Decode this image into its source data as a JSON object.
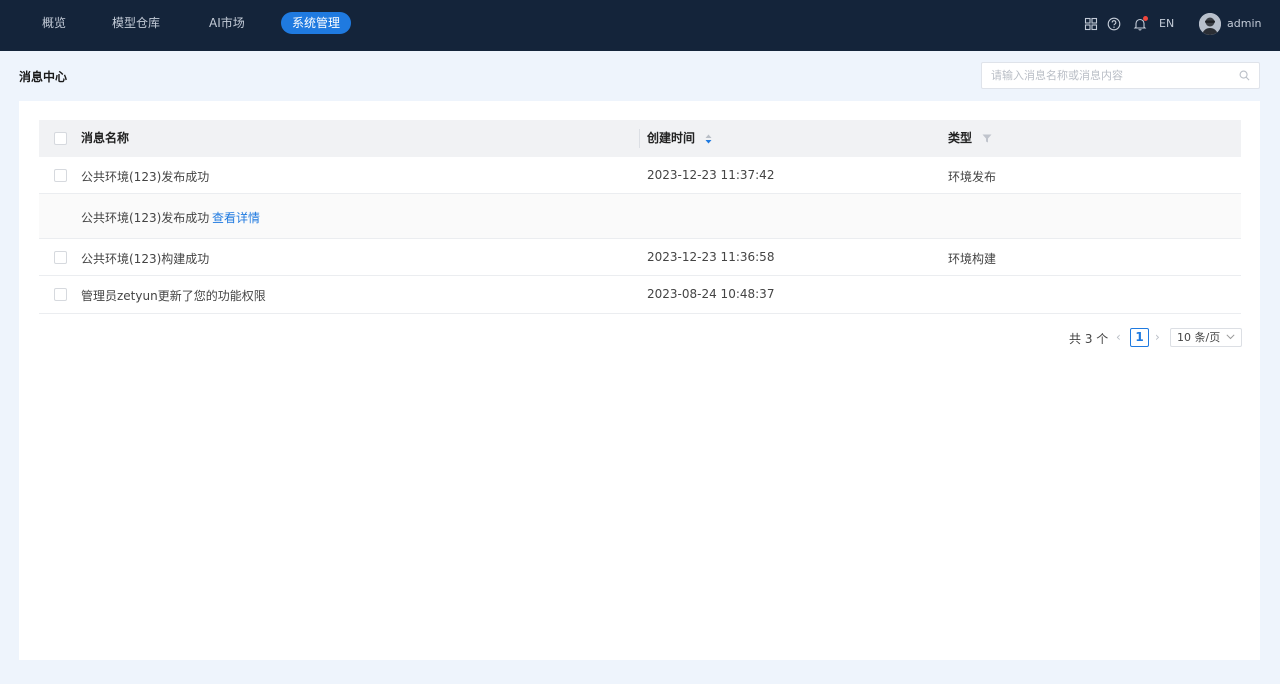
{
  "nav": {
    "items": [
      {
        "label": "概览",
        "active": false
      },
      {
        "label": "模型仓库",
        "active": false
      },
      {
        "label": "AI市场",
        "active": false
      },
      {
        "label": "系统管理",
        "active": true
      }
    ],
    "lang": "EN",
    "username": "admin",
    "icons": [
      "apps-grid-icon",
      "help-icon",
      "bell-icon"
    ]
  },
  "page": {
    "title": "消息中心",
    "search_placeholder": "请输入消息名称或消息内容"
  },
  "table": {
    "columns": {
      "name": "消息名称",
      "created": "创建时间",
      "type": "类型"
    },
    "rows": [
      {
        "name": "公共环境(123)发布成功",
        "created": "2023-12-23 11:37:42",
        "type": "环境发布"
      },
      {
        "name": "公共环境(123)构建成功",
        "created": "2023-12-23 11:36:58",
        "type": "环境构建"
      },
      {
        "name": "管理员zetyun更新了您的功能权限",
        "created": "2023-08-24 10:48:37",
        "type": ""
      }
    ],
    "expanded": {
      "content": "公共环境(123)发布成功",
      "link": "查看详情"
    }
  },
  "pagination": {
    "total": "共 3 个",
    "current_page": "1",
    "page_size": "10 条/页"
  },
  "colors": {
    "accent": "#1f7ae0",
    "nav_bg": "#14243a",
    "page_bg": "#eef4fc"
  }
}
